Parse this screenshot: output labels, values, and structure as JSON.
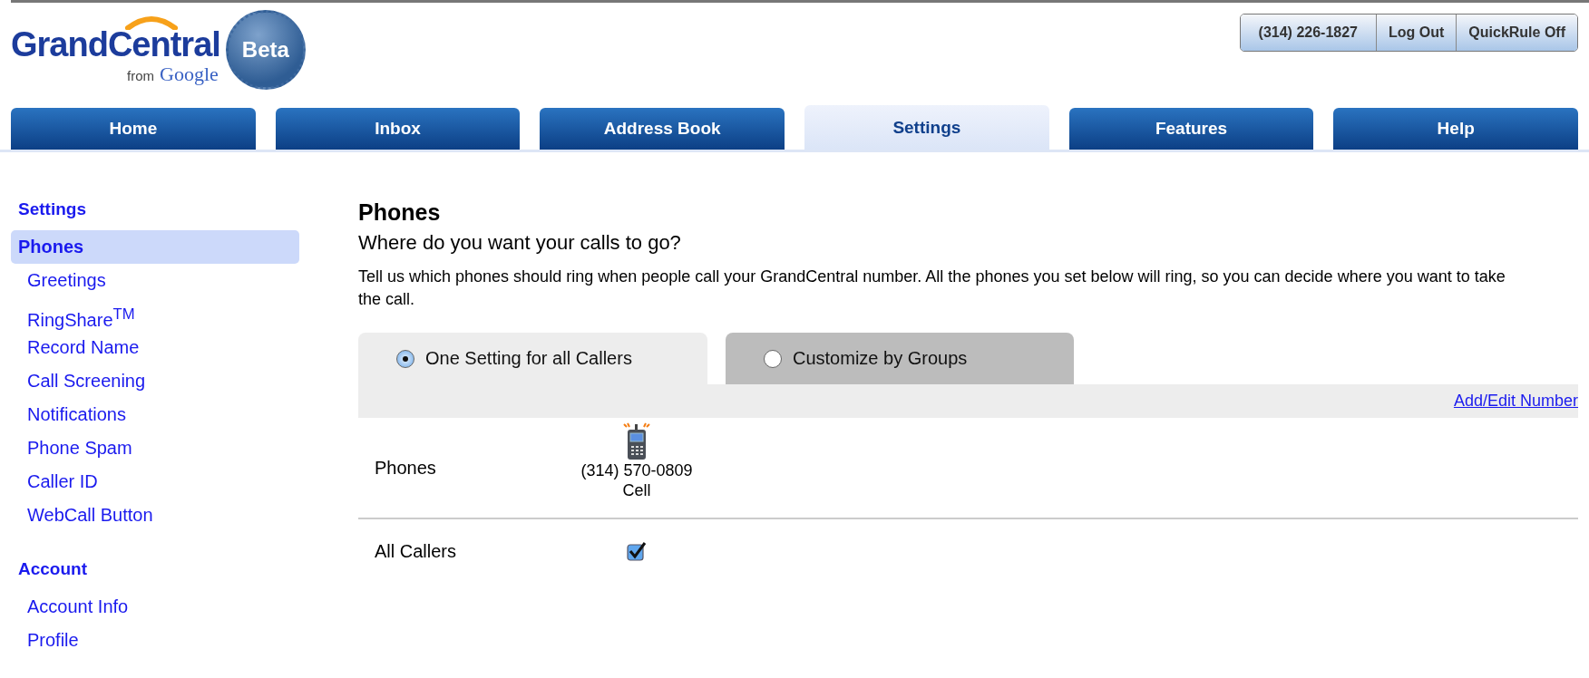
{
  "logo": {
    "name": "GrandCentral",
    "byline": "from",
    "brand": "Google",
    "badge": "Beta"
  },
  "account_buttons": [
    "(314) 226-1827",
    "Log Out",
    "QuickRule Off"
  ],
  "nav_tabs": [
    {
      "label": "Home",
      "selected": false
    },
    {
      "label": "Inbox",
      "selected": false
    },
    {
      "label": "Address Book",
      "selected": false
    },
    {
      "label": "Settings",
      "selected": true
    },
    {
      "label": "Features",
      "selected": false
    },
    {
      "label": "Help",
      "selected": false
    }
  ],
  "sidebar": [
    {
      "heading": "Settings",
      "items": [
        {
          "label": "Phones",
          "selected": true
        },
        {
          "label": "Greetings",
          "selected": false
        },
        {
          "label": "RingShare$^{TM}$",
          "selected": false
        },
        {
          "label": "Record Name",
          "selected": false
        },
        {
          "label": "Call Screening",
          "selected": false
        },
        {
          "label": "Notifications",
          "selected": false
        },
        {
          "label": "Phone Spam",
          "selected": false
        },
        {
          "label": "Caller ID",
          "selected": false
        },
        {
          "label": "WebCall Button",
          "selected": false
        }
      ]
    },
    {
      "heading": "Account",
      "items": [
        {
          "label": "Account Info",
          "selected": false
        },
        {
          "label": "Profile",
          "selected": false
        }
      ]
    }
  ],
  "main": {
    "title": "Phones",
    "subtitle": "Where do you want your calls to go?",
    "description": "Tell us which phones should ring when people call your GrandCentral number. All the phones you set below will ring, so you can decide where you want to take the call.",
    "mode_tabs": [
      {
        "label": "One Setting for all Callers",
        "selected": true
      },
      {
        "label": "Customize by Groups",
        "selected": false
      }
    ],
    "add_edit_link": "Add/Edit Number",
    "phones_row": {
      "label": "Phones",
      "phones": [
        {
          "number": "(314) 570-0809",
          "type": "Cell"
        }
      ]
    },
    "callers_row": {
      "label": "All Callers",
      "checks": [
        {
          "checked": true
        }
      ]
    }
  }
}
